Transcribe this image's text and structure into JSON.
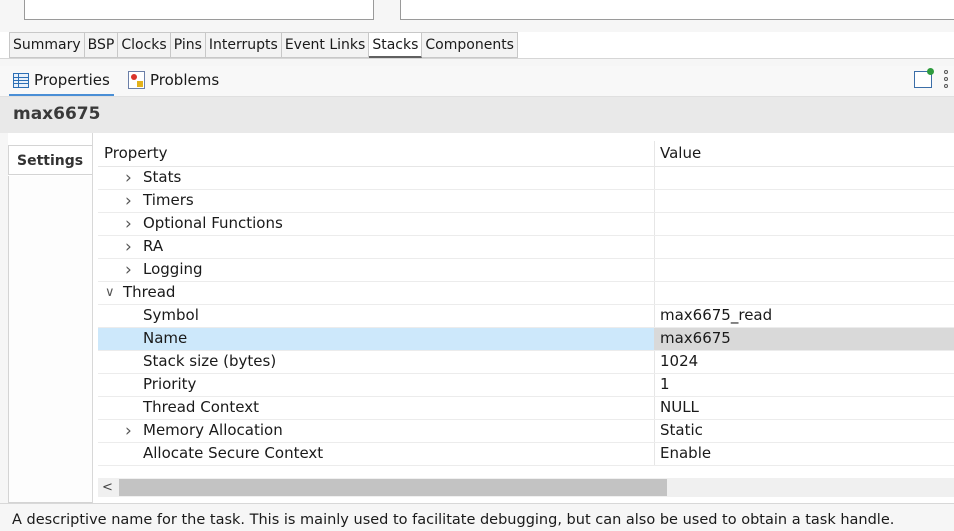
{
  "editor_tabs": [
    {
      "label": "Summary",
      "active": false
    },
    {
      "label": "BSP",
      "active": false
    },
    {
      "label": "Clocks",
      "active": false
    },
    {
      "label": "Pins",
      "active": false
    },
    {
      "label": "Interrupts",
      "active": false
    },
    {
      "label": "Event Links",
      "active": false
    },
    {
      "label": "Stacks",
      "active": true
    },
    {
      "label": "Components",
      "active": false
    }
  ],
  "view_tabs": {
    "properties": "Properties",
    "problems": "Problems"
  },
  "panel": {
    "title": "max6675",
    "settings_tab": "Settings",
    "columns": {
      "property": "Property",
      "value": "Value"
    }
  },
  "rows": [
    {
      "name": "Stats",
      "value": "",
      "indent": 1,
      "chevron": "collapsed"
    },
    {
      "name": "Timers",
      "value": "",
      "indent": 1,
      "chevron": "collapsed"
    },
    {
      "name": "Optional Functions",
      "value": "",
      "indent": 1,
      "chevron": "collapsed"
    },
    {
      "name": "RA",
      "value": "",
      "indent": 1,
      "chevron": "collapsed"
    },
    {
      "name": "Logging",
      "value": "",
      "indent": 1,
      "chevron": "collapsed"
    },
    {
      "name": "Thread",
      "value": "",
      "indent": 0,
      "chevron": "expanded"
    },
    {
      "name": "Symbol",
      "value": "max6675_read",
      "indent": 1,
      "chevron": "none"
    },
    {
      "name": "Name",
      "value": "max6675",
      "indent": 1,
      "chevron": "none",
      "selected": true
    },
    {
      "name": "Stack size (bytes)",
      "value": "1024",
      "indent": 1,
      "chevron": "none"
    },
    {
      "name": "Priority",
      "value": "1",
      "indent": 1,
      "chevron": "none"
    },
    {
      "name": "Thread Context",
      "value": "NULL",
      "indent": 1,
      "chevron": "none"
    },
    {
      "name": "Memory Allocation",
      "value": "Static",
      "indent": 1,
      "chevron": "collapsed"
    },
    {
      "name": "Allocate Secure Context",
      "value": "Enable",
      "indent": 1,
      "chevron": "none"
    }
  ],
  "status_text": "A descriptive name for the task. This is mainly used to facilitate debugging, but can also be used to obtain a task handle.",
  "icons": {
    "properties": "properties-icon",
    "problems": "problems-icon",
    "pin": "pin-view-icon",
    "menu": "view-menu-icon",
    "chevron_right": "chevron-right-icon",
    "chevron_down": "chevron-down-icon",
    "scroll_left": "scroll-left-arrow-icon"
  },
  "colors": {
    "selection": "#cde8fb",
    "active_view_tab": "#4a8fd6"
  }
}
